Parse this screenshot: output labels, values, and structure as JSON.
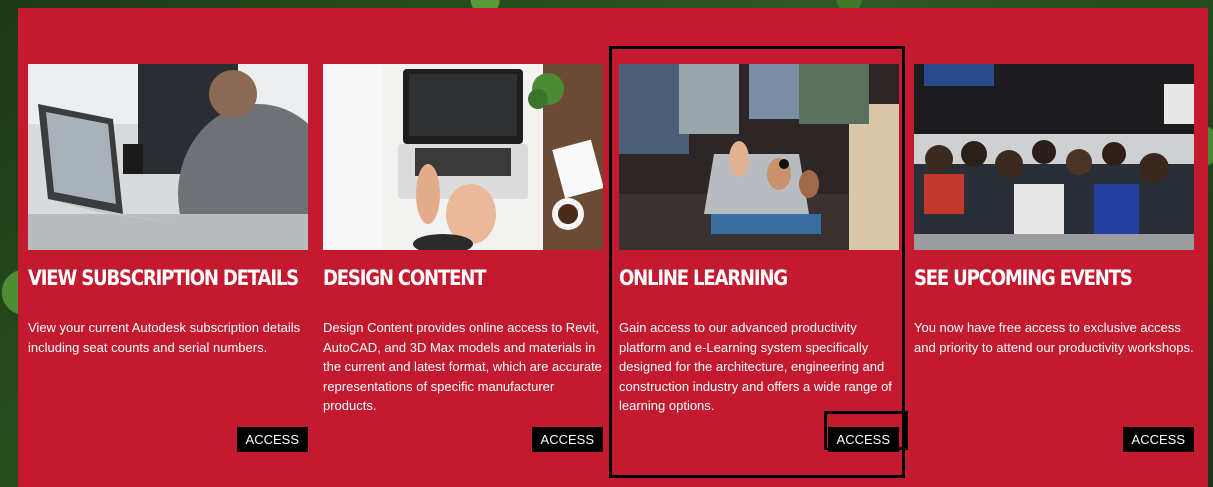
{
  "cards": [
    {
      "title": "VIEW SUBSCRIPTION DETAILS",
      "description": "View your current Autodesk subscription details including seat counts and serial numbers.",
      "button_label": "ACCESS"
    },
    {
      "title": "DESIGN CONTENT",
      "description": "Design Content provides online access to Revit, AutoCAD, and 3D Max models and materials in the current and latest format, which are accurate representations of specific manufacturer products.",
      "button_label": "ACCESS"
    },
    {
      "title": "ONLINE LEARNING",
      "description": "Gain access to our advanced productivity platform and e-Learning system specifically designed for the architecture, engineering and construction industry and offers a wide range of learning options.",
      "button_label": "ACCESS"
    },
    {
      "title": "SEE UPCOMING EVENTS",
      "description": "You now have free access to exclusive access and priority to attend our productivity workshops.",
      "button_label": "ACCESS"
    }
  ],
  "colors": {
    "panel": "#c41a2f",
    "button": "#000000",
    "text": "#ffffff",
    "highlight_outline": "#000000"
  }
}
